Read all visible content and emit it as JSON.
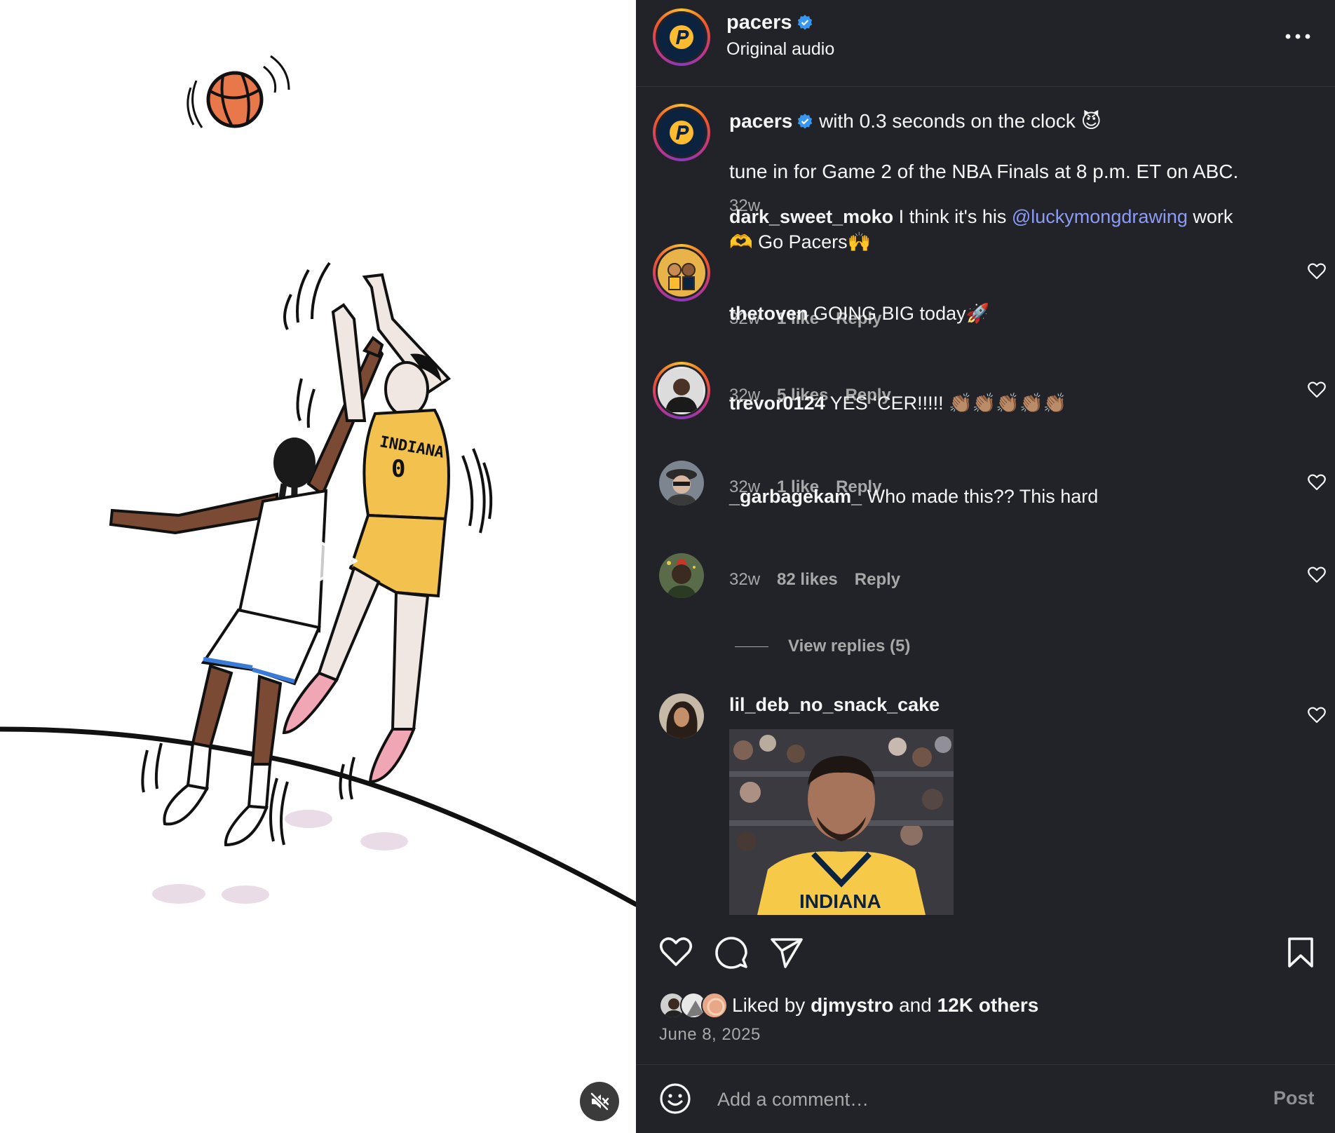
{
  "post": {
    "author": "pacers",
    "audio": "Original audio",
    "caption_line1": "with 0.3 seconds on the clock",
    "caption_emoji": "😈",
    "caption_line2": "tune in for Game 2 of the NBA Finals at 8 p.m. ET on ABC.",
    "caption_age": "32w",
    "jersey_text": "INDIANA",
    "jersey_number": "0"
  },
  "comments": [
    {
      "user": "dark_sweet_moko",
      "text_before": "I think it's his",
      "mention": "@luckymongdrawing",
      "text_after": "work",
      "line2": "🫶 Go Pacers🙌",
      "age": "32w",
      "likes": "1 like",
      "reply": "Reply"
    },
    {
      "user": "thetoven",
      "text": "GOING BIG today🚀",
      "age": "32w",
      "likes": "5 likes",
      "reply": "Reply"
    },
    {
      "user": "trevor0124",
      "text": "YES ‘CER!!!!! 👏🏽👏🏽👏🏽👏🏽👏🏽",
      "age": "32w",
      "likes": "1 like",
      "reply": "Reply"
    },
    {
      "user": "_garbagekam_",
      "text": "Who made this?? This hard",
      "age": "32w",
      "likes": "82 likes",
      "reply": "Reply",
      "view_replies": "View replies (5)"
    },
    {
      "user": "lil_deb_no_snack_cake",
      "gif_text": "INDIANA"
    }
  ],
  "likes": {
    "prefix": "Liked by",
    "user": "djmystro",
    "middle": "and",
    "others": "12K others"
  },
  "date": "June 8, 2025",
  "composer": {
    "placeholder": "Add a comment…",
    "post_label": "Post"
  },
  "colors": {
    "panel_bg": "#212328",
    "verified": "#3897f0",
    "mention": "#8c9cf5",
    "muted_text": "#a8a8a8",
    "jersey_yellow": "#f2c14e"
  },
  "icons": {
    "header_more": "more-horizontal-icon",
    "verified": "verified-badge-icon",
    "like": "heart-icon",
    "comment": "comment-bubble-icon",
    "share": "paper-plane-icon",
    "save": "bookmark-icon",
    "mute": "speaker-muted-icon",
    "play": "play-icon",
    "emoji": "smiley-icon"
  }
}
